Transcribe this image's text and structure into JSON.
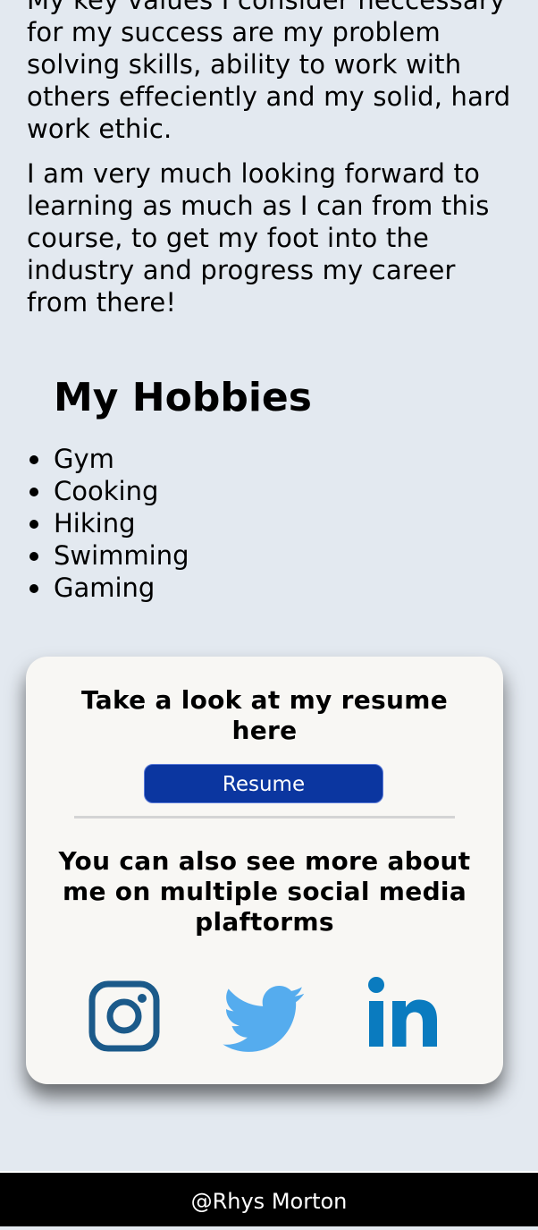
{
  "about": {
    "paragraphs": [
      "My key values I consider neccessary for my success are my problem solving skills, ability to work with others effeciently and my solid, hard work ethic.",
      "I am very much looking forward to learning as much as I can from this course, to get my foot into the industry and progress my career from there!"
    ]
  },
  "hobbies": {
    "title": "My Hobbies",
    "items": [
      "Gym",
      "Cooking",
      "Hiking",
      "Swimming",
      "Gaming"
    ]
  },
  "card": {
    "resume_heading": "Take a look at my resume here",
    "resume_button_label": "Resume",
    "social_heading": "You can also see more about me on multiple social media plaftorms",
    "social_links": [
      {
        "name": "instagram-icon",
        "color": "#1b5a8a"
      },
      {
        "name": "twitter-icon",
        "color": "#55acee"
      },
      {
        "name": "linkedin-icon",
        "color": "#0a7bbf"
      }
    ],
    "background": "#f8f7f4",
    "button_color": "#0b36a0"
  },
  "footer": {
    "text": "@Rhys Morton"
  },
  "colors": {
    "page_background": "#e3e9f0",
    "footer_background": "#000000"
  }
}
